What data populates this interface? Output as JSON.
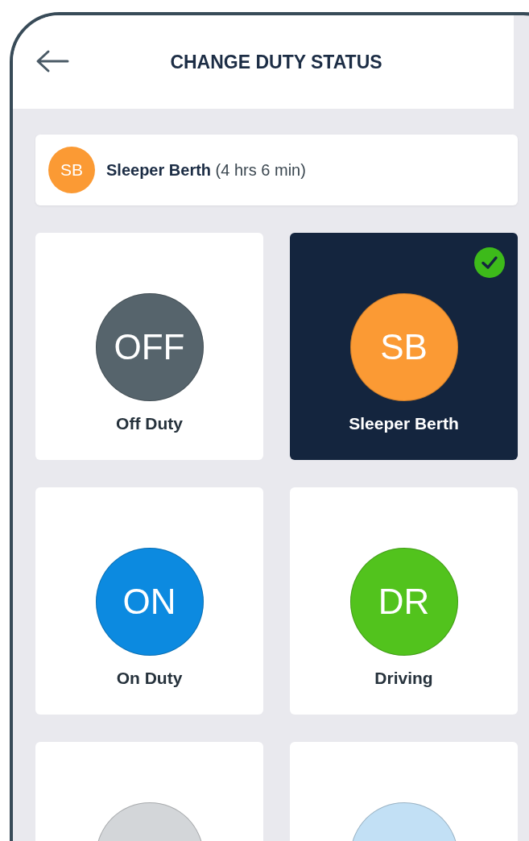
{
  "header": {
    "title": "CHANGE DUTY STATUS"
  },
  "current_status": {
    "code": "SB",
    "color": "#fb9a34",
    "text": "**Sleeper Berth** (4 hrs 6 min)"
  },
  "statuses": [
    {
      "code": "OFF",
      "label": "Off Duty",
      "color": "#56646c",
      "selected": false
    },
    {
      "code": "SB",
      "label": "Sleeper Berth",
      "color": "#fb9a34",
      "selected": true
    },
    {
      "code": "ON",
      "label": "On Duty",
      "color": "#0c8ae0",
      "selected": false
    },
    {
      "code": "DR",
      "label": "Driving",
      "color": "#52c31d",
      "selected": false
    },
    {
      "color": "#d3d6d9",
      "selected": false
    },
    {
      "color": "#c2e0f5",
      "selected": false
    }
  ]
}
